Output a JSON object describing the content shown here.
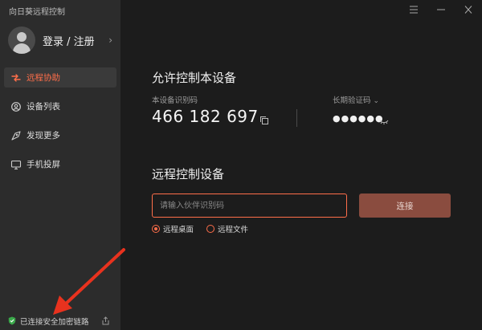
{
  "app": {
    "title": "向日葵远程控制"
  },
  "profile": {
    "label": "登录 / 注册"
  },
  "nav": {
    "items": [
      {
        "label": "远程协助",
        "icon": "remote-assist-icon",
        "active": true
      },
      {
        "label": "设备列表",
        "icon": "device-list-icon"
      },
      {
        "label": "发现更多",
        "icon": "discover-icon"
      },
      {
        "label": "手机投屏",
        "icon": "screen-cast-icon"
      }
    ]
  },
  "status": {
    "label": "已连接安全加密链路"
  },
  "allow": {
    "title": "允许控制本设备",
    "device_id_label": "本设备识别码",
    "device_id": "466 182 697",
    "password_label": "长期验证码",
    "password_mask": "●●●●●●"
  },
  "remote": {
    "title": "远程控制设备",
    "input_placeholder": "请输入伙伴识别码",
    "connect_label": "连接",
    "modes": [
      {
        "label": "远程桌面",
        "checked": true
      },
      {
        "label": "远程文件",
        "checked": false
      }
    ]
  },
  "colors": {
    "accent": "#ff6e4a",
    "sidebar": "#2c2c2c",
    "main": "#1c1c1c",
    "annotation": "#e8321e"
  }
}
